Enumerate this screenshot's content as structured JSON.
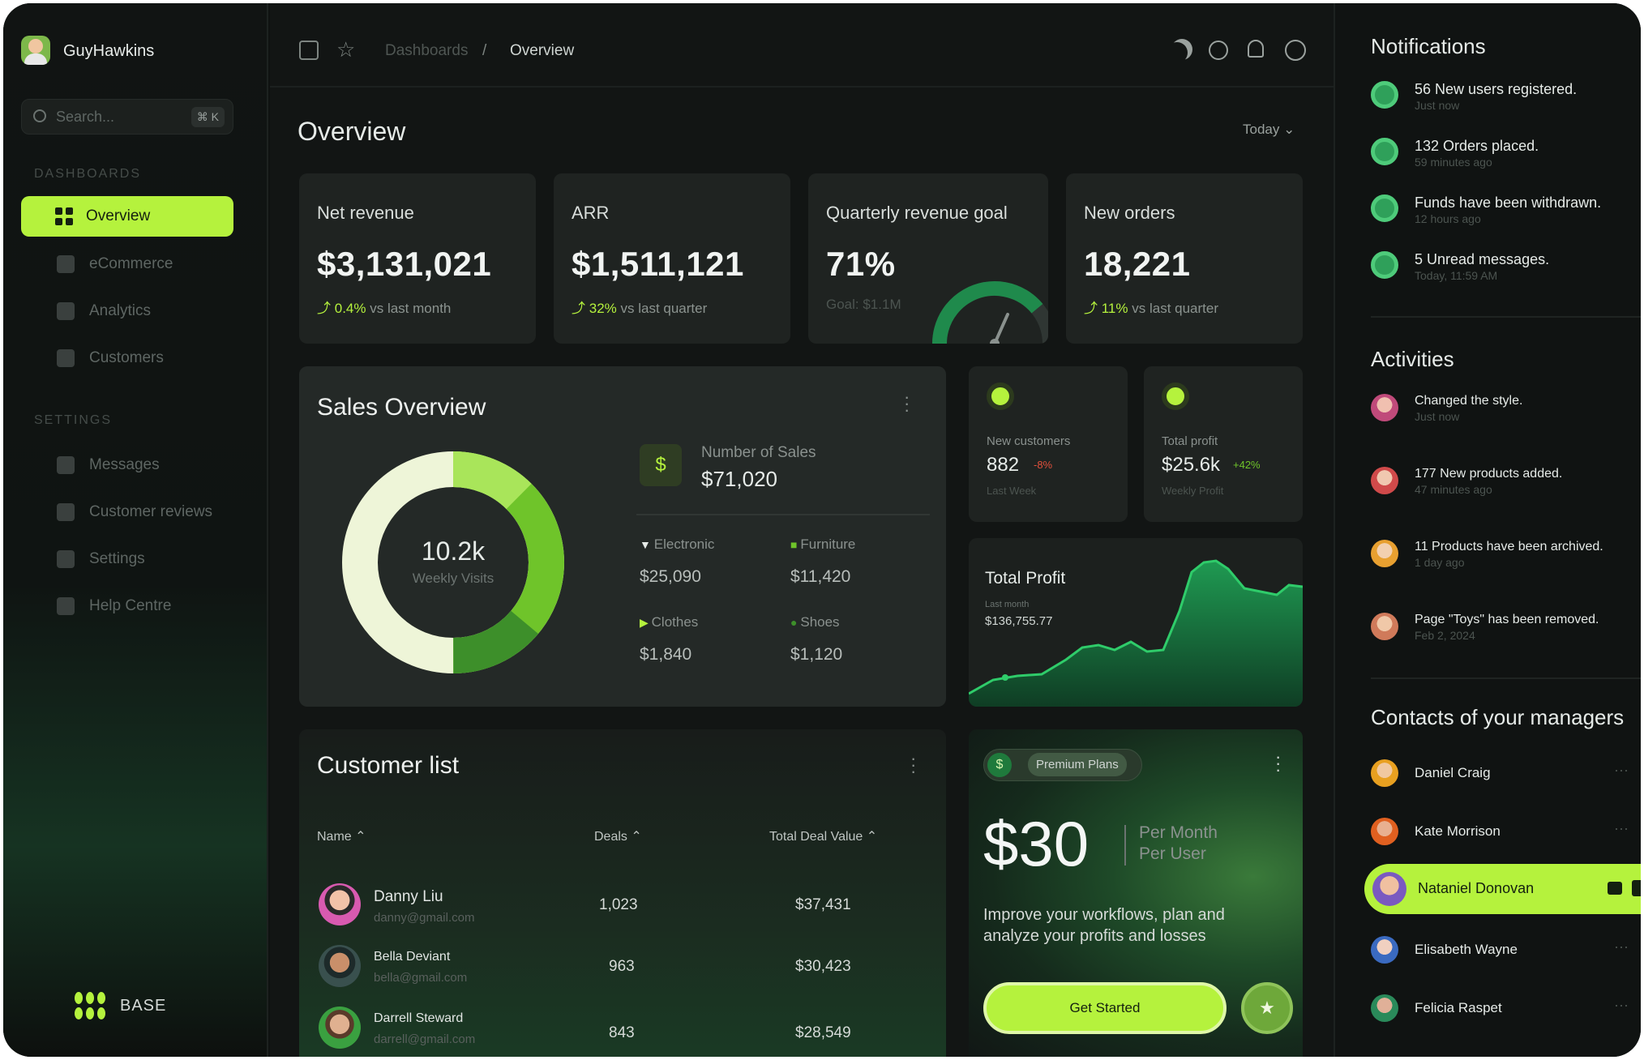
{
  "user": {
    "name": "GuyHawkins"
  },
  "search": {
    "placeholder": "Search...",
    "shortcut": "⌘ K"
  },
  "sidebar": {
    "section_dashboards": "DASHBOARDS",
    "section_settings": "SETTINGS",
    "items": [
      {
        "label": "Overview",
        "icon": "grid-icon",
        "active": true
      },
      {
        "label": "eCommerce",
        "icon": "bag-icon"
      },
      {
        "label": "Analytics",
        "icon": "bar-chart-icon"
      },
      {
        "label": "Customers",
        "icon": "users-icon"
      }
    ],
    "settings_items": [
      {
        "label": "Messages",
        "icon": "message-icon"
      },
      {
        "label": "Customer reviews",
        "icon": "star-icon"
      },
      {
        "label": "Settings",
        "icon": "gear-icon"
      },
      {
        "label": "Help Centre",
        "icon": "help-icon"
      }
    ],
    "brand": "BASE"
  },
  "header": {
    "breadcrumb_root": "Dashboards",
    "breadcrumb_sep": "/",
    "breadcrumb_current": "Overview"
  },
  "page": {
    "title": "Overview",
    "range": "Today"
  },
  "kpis": [
    {
      "title": "Net revenue",
      "value": "$3,131,021",
      "delta": "0.4%",
      "delta_text": "vs last month"
    },
    {
      "title": "ARR",
      "value": "$1,511,121",
      "delta": "32%",
      "delta_text": "vs last quarter"
    },
    {
      "title": "Quarterly revenue goal",
      "value": "71%",
      "sub": "Goal: $1.1M",
      "gauge_fraction": 0.71
    },
    {
      "title": "New orders",
      "value": "18,221",
      "delta": "11%",
      "delta_text": "vs last quarter"
    }
  ],
  "sales": {
    "title": "Sales Overview",
    "center_value": "10.2k",
    "center_label": "Weekly Visits",
    "number_label": "Number of Sales",
    "number_value": "$71,020",
    "categories": [
      {
        "name": "Electronic",
        "value": "$25,090"
      },
      {
        "name": "Furniture",
        "value": "$11,420"
      },
      {
        "name": "Clothes",
        "value": "$1,840"
      },
      {
        "name": "Shoes",
        "value": "$1,120"
      }
    ]
  },
  "mini_cards": [
    {
      "label": "New customers",
      "value": "882",
      "delta": "-8%",
      "sub": "Last Week"
    },
    {
      "label": "Total profit",
      "value": "$25.6k",
      "delta": "+42%",
      "sub": "Weekly Profit"
    }
  ],
  "profit": {
    "title": "Total Profit",
    "sub": "Last month",
    "value": "$136,755.77"
  },
  "customers": {
    "title": "Customer list",
    "columns": [
      "Name",
      "Deals",
      "Total Deal Value"
    ],
    "rows": [
      {
        "name": "Danny Liu",
        "email": "danny@gmail.com",
        "deals": "1,023",
        "value": "$37,431"
      },
      {
        "name": "Bella Deviant",
        "email": "bella@gmail.com",
        "deals": "963",
        "value": "$30,423"
      },
      {
        "name": "Darrell Steward",
        "email": "darrell@gmail.com",
        "deals": "843",
        "value": "$28,549"
      }
    ]
  },
  "premium": {
    "badge": "Premium Plans",
    "price": "$30",
    "per_month": "Per Month",
    "per_user": "Per User",
    "desc_line1": "Improve your workflows, plan and",
    "desc_line2": "analyze your profits and losses",
    "cta": "Get Started"
  },
  "right": {
    "notifications_title": "Notifications",
    "notifications": [
      {
        "text": "56 New users registered.",
        "time": "Just now"
      },
      {
        "text": "132 Orders placed.",
        "time": "59 minutes ago"
      },
      {
        "text": "Funds have been withdrawn.",
        "time": "12 hours ago"
      },
      {
        "text": "5 Unread messages.",
        "time": "Today, 11:59 AM"
      }
    ],
    "activities_title": "Activities",
    "activities": [
      {
        "text": "Changed the style.",
        "time": "Just now"
      },
      {
        "text": "177 New products added.",
        "time": "47 minutes ago"
      },
      {
        "text": "11 Products have been archived.",
        "time": "1 day ago"
      },
      {
        "text": "Page \"Toys\" has been removed.",
        "time": "Feb 2, 2024"
      }
    ],
    "contacts_title": "Contacts of your managers",
    "contacts": [
      {
        "name": "Daniel Craig"
      },
      {
        "name": "Kate Morrison"
      },
      {
        "name": "Nataniel Donovan",
        "active": true
      },
      {
        "name": "Elisabeth Wayne"
      },
      {
        "name": "Felicia Raspet"
      }
    ]
  },
  "colors": {
    "accent": "#b5f23d",
    "bg": "#121514",
    "card": "#1f2321"
  }
}
